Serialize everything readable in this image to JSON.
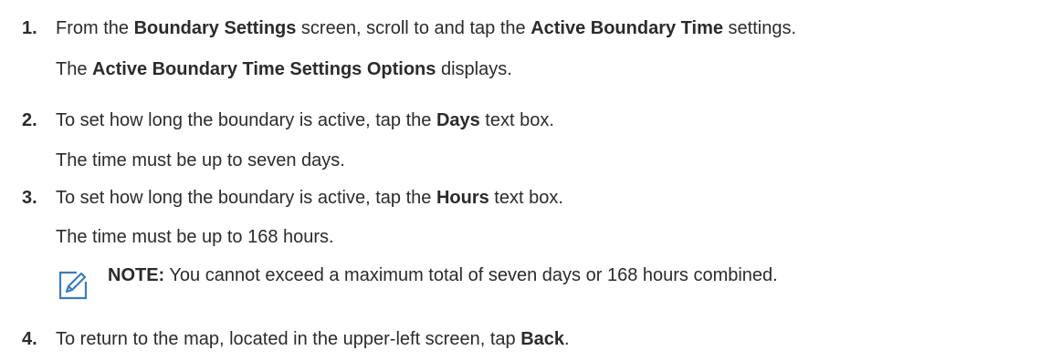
{
  "steps": [
    {
      "number": "1.",
      "lines": [
        [
          "From the ",
          "Boundary Settings",
          " screen, scroll to and tap the ",
          "Active Boundary Time",
          " settings."
        ],
        [
          "The ",
          "Active Boundary Time Settings Options",
          " displays."
        ]
      ]
    },
    {
      "number": "2.",
      "lines": [
        [
          "To set how long the boundary is active, tap the ",
          "Days",
          " text box."
        ],
        [
          "The time must be up to seven days."
        ]
      ]
    },
    {
      "number": "3.",
      "lines": [
        [
          "To set how long the boundary is active, tap the ",
          "Hours",
          " text box."
        ],
        [
          "The time must be up to 168 hours."
        ]
      ]
    },
    {
      "number": "4.",
      "lines": [
        [
          "To return to the map, located in the upper-left screen, tap ",
          "Back",
          "."
        ]
      ]
    }
  ],
  "note": {
    "icon": "note-pencil-icon",
    "label": "NOTE:",
    "text": " You cannot exceed a maximum total of seven days or 168 hours combined."
  },
  "colors": {
    "text": "#2b2b2b",
    "icon": "#3a7bbf"
  }
}
